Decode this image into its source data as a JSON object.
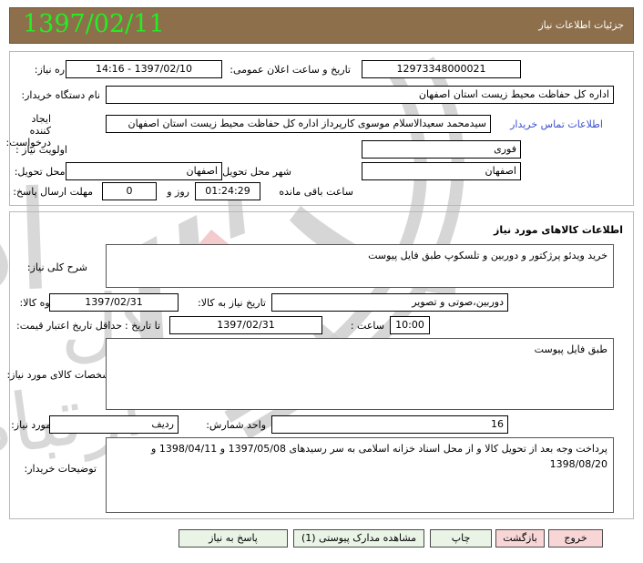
{
  "header": {
    "title": "جزئیات اطلاعات نیاز",
    "date": "1397/02/11",
    "bg_color": "#8d6f4c",
    "date_color": "#22ee22"
  },
  "top_panel": {
    "need_number_label": "شماره نیاز:",
    "need_number_value": "12973348000021",
    "announce_label": "تاریخ و ساعت اعلان عمومی:",
    "announce_value": "1397/02/10 - 14:16",
    "buyer_org_label": "نام دستگاه خریدار:",
    "buyer_org_value": "اداره کل حفاظت محیط زیست استان اصفهان",
    "creator_label": "ایجاد کننده درخواست:",
    "creator_value": "سیدمحمد سعیدالاسلام موسوی کارپرداز اداره کل حفاظت محیط زیست استان اصفهان",
    "contact_link": "اطلاعات تماس خریدار",
    "priority_label": "اولویت نیاز :",
    "priority_value": "فوری",
    "province_label": "استان محل تحویل:",
    "province_value": "اصفهان",
    "city_label": "شهر محل تحویل:",
    "city_value": "اصفهان",
    "deadline_label": "مهلت ارسال پاسخ:",
    "deadline_days": "0",
    "deadline_days_suffix": "روز و",
    "deadline_time": "01:24:29",
    "deadline_suffix": "ساعت باقی مانده"
  },
  "goods_panel": {
    "section_title": "اطلاعات کالاهای مورد نیاز",
    "general_desc_label": "شرح کلی نیاز:",
    "general_desc_value": "خرید ویدئو پرژکتور و دوربین و تلسکوپ طبق فایل پیوست",
    "group_label": "گروه کالا:",
    "group_value": "دوربین،صوتی و تصویر",
    "need_date_label": "تاریخ نیاز به کالا:",
    "need_date_value": "1397/02/31",
    "price_validity_label": "حداقل تاریخ اعتبار قیمت:",
    "price_validity_until_label": "تا تاریخ :",
    "price_validity_date": "1397/02/31",
    "price_validity_time_label": "ساعت :",
    "price_validity_time": "10:00",
    "specs_label": "مشخصات کالای مورد نیاز:",
    "specs_value": "طبق فایل پیوست",
    "quantity_label": "تعداد / مقدار مورد نیاز:",
    "quantity_value": "16",
    "unit_label": "واحد شمارش:",
    "unit_value": "ردیف",
    "buyer_notes_label": "توضیحات خریدار:",
    "buyer_notes_value": "پرداخت وجه بعد از تحویل کالا و از محل اسناد خزانه اسلامی به سر رسیدهای 1397/05/08 و 1398/04/11 و 1398/08/20"
  },
  "buttons": {
    "respond": "پاسخ به نیاز",
    "view_attachments": "مشاهده مدارک پیوستی (1)",
    "print": "چاپ",
    "back": "بازگشت",
    "exit": "خروج",
    "green_bg": "#eaf4e6",
    "red_bg": "#f8d6d6"
  }
}
